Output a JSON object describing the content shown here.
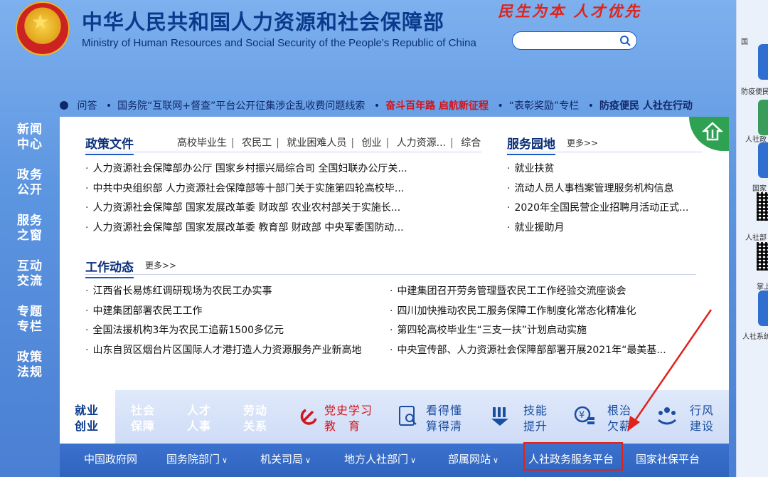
{
  "header": {
    "title": "中华人民共和国人力资源和社会保障部",
    "subtitle": "Ministry of Human Resources and Social Security of the People's Republic of China",
    "slogan": "民生为本 人才优先",
    "search_placeholder": ""
  },
  "ticker": {
    "items": [
      "问答",
      "国务院“互联网+督查”平台公开征集涉企乱收费问题线索",
      "奋斗百年路 启航新征程",
      "“表彰奖励”专栏",
      "防疫便民 人社在行动"
    ]
  },
  "left_nav": [
    "新闻中心",
    "政务公开",
    "服务之窗",
    "互动交流",
    "专题专栏",
    "政策法规"
  ],
  "policy": {
    "title": "政策文件",
    "tabs": [
      "高校毕业生",
      "农民工",
      "就业困难人员",
      "创业",
      "人力资源...",
      "综合"
    ],
    "items": [
      "人力资源社会保障部办公厅 国家乡村振兴局综合司 全国妇联办公厅关...",
      "中共中央组织部 人力资源社会保障部等十部门关于实施第四轮高校毕...",
      "人力资源社会保障部 国家发展改革委 财政部 农业农村部关于实施长...",
      "人力资源社会保障部 国家发展改革委 教育部 财政部 中央军委国防动..."
    ]
  },
  "service": {
    "title": "服务园地",
    "more": "更多>>",
    "items": [
      "就业扶贫",
      "流动人员人事档案管理服务机构信息",
      "2020年全国民营企业招聘月活动正式...",
      "就业援助月"
    ]
  },
  "news": {
    "title": "工作动态",
    "more": "更多>>",
    "left": [
      "江西省长易炼红调研现场为农民工办实事",
      "中建集团部署农民工工作",
      "全国法援机构3年为农民工追薪1500多亿元",
      "山东自贸区烟台片区国际人才港打造人力资源服务产业新高地"
    ],
    "right": [
      "中建集团召开劳务管理暨农民工工作经验交流座谈会",
      "四川加快推动农民工服务保障工作制度化常态化精准化",
      "第四轮高校毕业生“三支一扶”计划启动实施",
      "中央宣传部、人力资源社会保障部部署开展2021年“最美基..."
    ]
  },
  "bottom_tabs": {
    "t1": [
      "就业",
      "创业"
    ],
    "t2": [
      "社会",
      "保障"
    ],
    "t3": [
      "人才",
      "人事"
    ],
    "t4": [
      "劳动",
      "关系"
    ],
    "t5": [
      "党史学习",
      "教　育"
    ],
    "t6": [
      "看得懂",
      "算得清"
    ],
    "t7": [
      "技能",
      "提升"
    ],
    "t8": [
      "根治",
      "欠薪"
    ],
    "t9": [
      "行风",
      "建设"
    ]
  },
  "footer": {
    "links": [
      "中国政府网",
      "国务院部门",
      "机关司局",
      "地方人社部门",
      "部属网站",
      "人社政务服务平台",
      "国家社保平台"
    ]
  },
  "right_bar": {
    "labels": [
      "国",
      "防疫便民",
      "人社政",
      "国家",
      "人社部",
      "掌上",
      "人社系统"
    ]
  },
  "colors": {
    "accent": "#0b3a8c",
    "highlight": "#e0231a",
    "green": "#2fa152"
  }
}
